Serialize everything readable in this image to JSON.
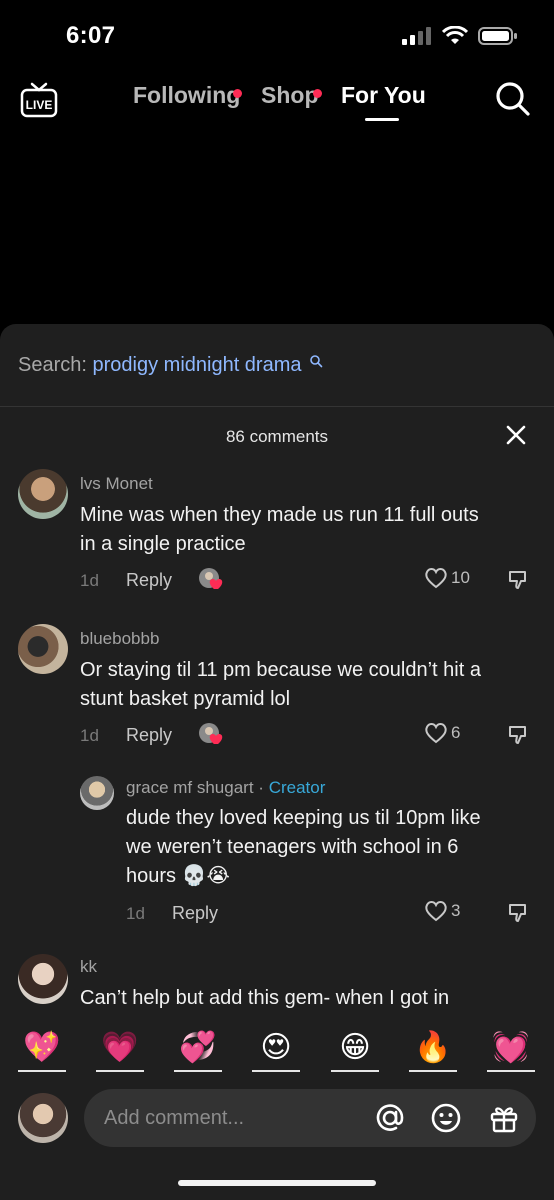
{
  "status_bar": {
    "time": "6:07"
  },
  "top_nav": {
    "live_label": "LIVE",
    "tabs": [
      {
        "label": "Following",
        "dot": true
      },
      {
        "label": "Shop",
        "dot": true
      },
      {
        "label": "For You",
        "active": true
      }
    ]
  },
  "comments_sheet": {
    "search_label": "Search:",
    "search_term": "prodigy midnight drama",
    "count_label": "86 comments",
    "comments": [
      {
        "username": "lvs Monet",
        "text_line1": "Mine was when they made us run 11 full outs",
        "text_line2": "in a single practice",
        "date": "1d",
        "reply": "Reply",
        "likes": "10"
      },
      {
        "username": "bluebobbb",
        "text_line1": "Or staying til 11 pm because we couldn’t hit a",
        "text_line2": "stunt basket pyramid lol",
        "date": "1d",
        "reply": "Reply",
        "likes": "6"
      },
      {
        "username": "grace mf shugart",
        "separator": "·",
        "badge": "Creator",
        "text_line1": "dude they loved keeping us til 10pm like",
        "text_line2": "we weren’t teenagers with school in 6",
        "text_line3": "hours 💀😭",
        "date": "1d",
        "reply": "Reply",
        "likes": "3"
      },
      {
        "username": "kk",
        "text_line1": "Can’t help but add this gem- when I got in"
      }
    ]
  },
  "emoji_bar": [
    "💖",
    "💗",
    "💞",
    "😍",
    "😁",
    "🔥",
    "💓"
  ],
  "input": {
    "placeholder": "Add comment..."
  },
  "colors": {
    "accent_red": "#fe2c55",
    "creator_blue": "#38a8d8",
    "search_term": "#8fb8ff",
    "sheet_bg": "#1f1f1f"
  }
}
